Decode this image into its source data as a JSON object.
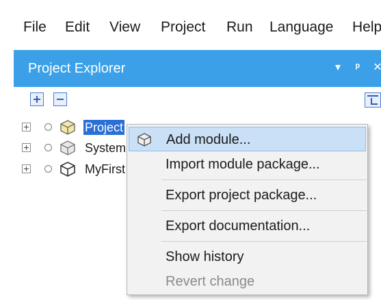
{
  "menubar": {
    "items": [
      "File",
      "Edit",
      "View",
      "Project",
      "Run",
      "Language",
      "Help"
    ]
  },
  "panel": {
    "title": "Project Explorer",
    "header_buttons": {
      "dropdown": "▾",
      "pin": "ᵖ",
      "close": "✕"
    }
  },
  "toolbar": {
    "expand_all_icon": "expand-all-icon",
    "collapse_all_icon": "collapse-all-icon",
    "sync_icon": "link-with-editor-icon"
  },
  "tree": {
    "items": [
      {
        "label": "Project",
        "selected": true,
        "icon": "project-cube-icon"
      },
      {
        "label": "System",
        "selected": false,
        "icon": "module-cube-icon"
      },
      {
        "label": "MyFirst",
        "selected": false,
        "icon": "module-cube-icon"
      }
    ]
  },
  "context_menu": {
    "items": [
      {
        "label": "Add module...",
        "hover": true,
        "enabled": true,
        "icon": "module-cube-icon"
      },
      {
        "label": "Import module package...",
        "hover": false,
        "enabled": true
      },
      {
        "label": "Export project package...",
        "hover": false,
        "enabled": true
      },
      {
        "label": "Export documentation...",
        "hover": false,
        "enabled": true
      },
      {
        "label": "Show history",
        "hover": false,
        "enabled": true
      },
      {
        "label": "Revert change",
        "hover": false,
        "enabled": false
      }
    ]
  },
  "colors": {
    "panel_header": "#3ba0e8",
    "selection": "#2a6fd6",
    "menu_hover": "#c9e0f7"
  }
}
